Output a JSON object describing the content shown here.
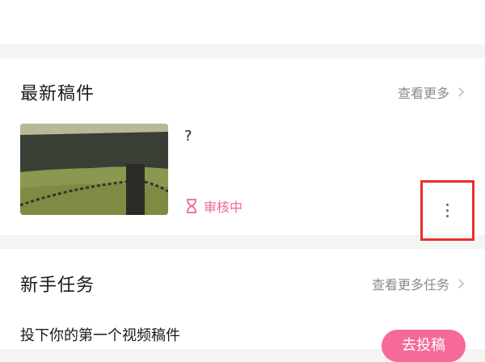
{
  "recent_drafts": {
    "title": "最新稿件",
    "more_label": "查看更多",
    "item": {
      "title": "?",
      "status": "审核中",
      "status_color": "#f06896",
      "thumbnail_icon": "video-thumbnail"
    }
  },
  "newbie_tasks": {
    "title": "新手任务",
    "more_label": "查看更多任务",
    "task": {
      "text": "投下你的第一个视频稿件",
      "button_label": "去投稿",
      "button_color": "#f56a9b"
    }
  },
  "highlight_color": "#e8312a"
}
